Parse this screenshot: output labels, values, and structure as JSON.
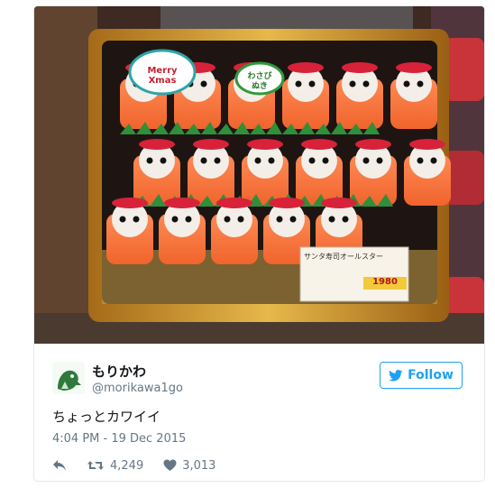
{
  "photo": {
    "badge_left": "Merry Xmas",
    "badge_right_line1": "わさび",
    "badge_right_line2": "ぬき",
    "label_title": "サンタ寿司オールスター",
    "price": "1980"
  },
  "tweet": {
    "display_name": "もりかわ",
    "handle": "@morikawa1go",
    "follow_label": "Follow",
    "text": "ちょっとカワイイ",
    "timestamp": "4:04 PM - 19 Dec 2015",
    "retweets": "4,249",
    "likes": "3,013"
  },
  "colors": {
    "twitter_blue": "#1da1f2",
    "muted": "#657786",
    "border": "#e1e8ed"
  },
  "icons": [
    "twitter-bird-icon",
    "reply-icon",
    "retweet-icon",
    "heart-icon"
  ]
}
